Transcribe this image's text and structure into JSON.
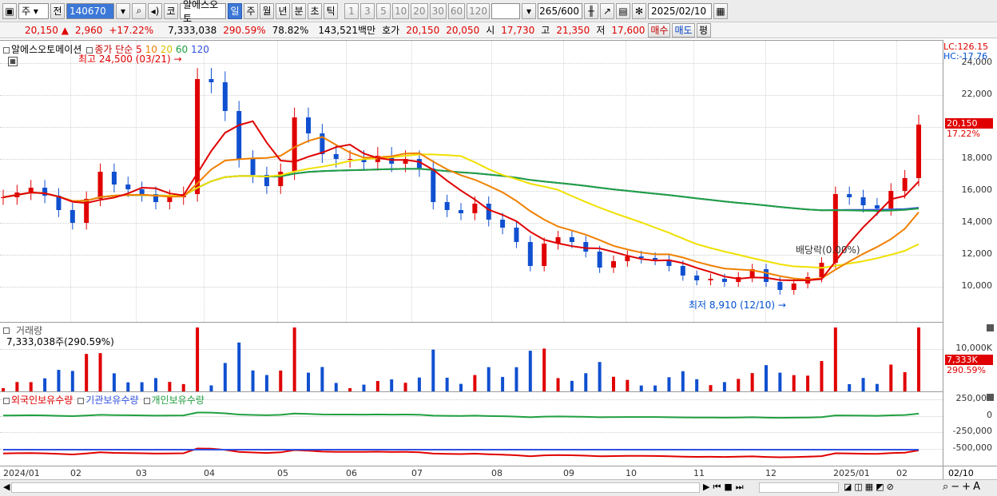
{
  "toolbar": {
    "market": "주",
    "prev": "전",
    "code": "140670",
    "period": "코",
    "name": "알에스오토",
    "tabs": [
      "일",
      "주",
      "월",
      "년",
      "분",
      "초",
      "틱"
    ],
    "active_tab": "일",
    "intervals": [
      "1",
      "3",
      "5",
      "10",
      "20",
      "30",
      "60",
      "120"
    ],
    "count": "265",
    "count_total": "/600",
    "date": "2025/02/10"
  },
  "quote": {
    "price": "20,150",
    "arrow": "▲",
    "change": "2,960",
    "change_pct": "+17.22%",
    "volume": "7,333,038",
    "vol_ratio": "290.59%",
    "turnover": "78.82%",
    "amount": "143,521백만",
    "hoga_label": "호가",
    "hoga1": "20,150",
    "hoga2": "20,050",
    "open_label": "시",
    "open": "17,730",
    "high_label": "고",
    "high": "21,350",
    "low_label": "저",
    "low": "17,600",
    "buy": "매수",
    "sell": "매도",
    "flat": "평"
  },
  "price_panel": {
    "title": "알에스오토메이션",
    "ma_label": "종가 단순",
    "ma_periods": [
      "5",
      "10",
      "20",
      "60",
      "120"
    ],
    "ma_colors": {
      "5": "#e00000",
      "10": "#f08000",
      "20": "#f0e000",
      "60": "#20a040",
      "120": "#3050e0"
    },
    "y_ticks": [
      "24,000",
      "22,000",
      "20,000",
      "18,000",
      "16,000",
      "14,000",
      "12,000",
      "10,000"
    ],
    "lc": "LC:126.15",
    "hc": "HC:-17.76",
    "last_price": "20,150",
    "last_pct": "17.22%",
    "high_ann": "최고 24,500 (03/21)",
    "low_ann": "최저 8,910 (12/10)",
    "dividend_ann": "배당락(0.00%)"
  },
  "volume_panel": {
    "title": "거래량",
    "value": "7,333,038주(290.59%)",
    "y_tick": "10,000K",
    "last": "7,333K",
    "last_pct": "290.59%"
  },
  "holdings_panel": {
    "titles": [
      "외국인보유수량",
      "기관보유수량",
      "개인보유수량"
    ],
    "colors": [
      "#e00000",
      "#3050e0",
      "#20a040"
    ],
    "y_ticks": [
      "250,000",
      "0",
      "-250,000",
      "-500,000"
    ]
  },
  "x_labels": [
    "2024/01",
    "02",
    "03",
    "04",
    "05",
    "06",
    "07",
    "08",
    "09",
    "10",
    "11",
    "12",
    "2025/01",
    "02",
    "02/10"
  ],
  "chart_data": {
    "type": "candlestick",
    "ylim": [
      8500,
      25000
    ],
    "series": [
      {
        "name": "종가",
        "values": [
          15600,
          15900,
          16200,
          15700,
          14800,
          14000,
          15500,
          17200,
          16400,
          16100,
          15800,
          15300,
          15600,
          15800,
          23000,
          22800,
          21000,
          18000,
          17000,
          16300,
          17200,
          20600,
          19600,
          18300,
          18000,
          18000,
          17800,
          18200,
          17700,
          18000,
          17400,
          15300,
          14800,
          14600,
          15200,
          14200,
          13700,
          12800,
          11300,
          12700,
          13100,
          12800,
          12200,
          11200,
          11600,
          11900,
          11800,
          11700,
          11300,
          10700,
          10400,
          10500,
          10300,
          10600,
          11100,
          10300,
          9800,
          10200,
          10600,
          11500,
          15800,
          15600,
          15100,
          14900,
          16000,
          16800,
          20150
        ]
      }
    ]
  }
}
